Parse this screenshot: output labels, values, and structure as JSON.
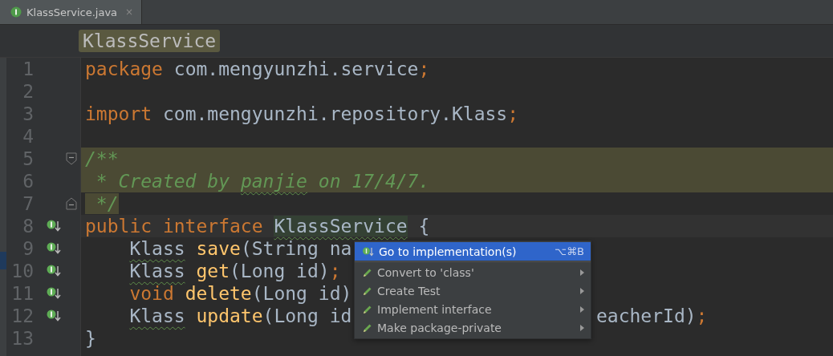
{
  "tab": {
    "title": "KlassService.java",
    "close": "×",
    "selected": true
  },
  "breadcrumb": {
    "label": "KlassService"
  },
  "lines": [
    {
      "number": "1",
      "tokens": [
        {
          "text": "package",
          "kind": "keyword"
        },
        {
          "text": " com.mengyunzhi.service",
          "kind": "plain"
        },
        {
          "text": ";",
          "kind": "keyword"
        }
      ]
    },
    {
      "number": "2"
    },
    {
      "number": "3",
      "tokens": [
        {
          "text": "import",
          "kind": "keyword"
        },
        {
          "text": " com.mengyunzhi.repository.Klass",
          "kind": "plain"
        },
        {
          "text": ";",
          "kind": "keyword"
        }
      ]
    },
    {
      "number": "4"
    },
    {
      "number": "5",
      "highlighted": true,
      "fold_start": true,
      "tokens": [
        {
          "text": "/**",
          "kind": "comment"
        }
      ]
    },
    {
      "number": "6",
      "highlighted": true,
      "tokens": [
        {
          "text": " * Created by ",
          "kind": "comment"
        },
        {
          "text": "panjie",
          "kind": "comment",
          "warn": true
        },
        {
          "text": " on 17/4/7.",
          "kind": "comment"
        }
      ]
    },
    {
      "number": "7",
      "highlighted": true,
      "fold_end": true,
      "tokens": [
        {
          "text": " */",
          "kind": "comment"
        }
      ]
    },
    {
      "number": "8",
      "current": true,
      "implemented": true,
      "tokens": [
        {
          "text": "public interface ",
          "kind": "keyword"
        },
        {
          "text": "KlassService",
          "kind": "plain",
          "warn": true,
          "marked": true
        },
        {
          "text": " {",
          "kind": "plain"
        }
      ]
    },
    {
      "number": "9",
      "implemented": true,
      "indented": true,
      "tokens": [
        {
          "text": "Klass",
          "kind": "plain",
          "warn": true
        },
        {
          "text": " save",
          "kind": "method"
        },
        {
          "text": "(String na",
          "kind": "plain"
        }
      ]
    },
    {
      "number": "10",
      "implemented": true,
      "indented": true,
      "tokens": [
        {
          "text": "Klass",
          "kind": "plain",
          "warn": true
        },
        {
          "text": " get",
          "kind": "method"
        },
        {
          "text": "(Long id)",
          "kind": "plain"
        },
        {
          "text": ";",
          "kind": "keyword"
        }
      ]
    },
    {
      "number": "11",
      "implemented": true,
      "indented": true,
      "tokens": [
        {
          "text": "void ",
          "kind": "keyword"
        },
        {
          "text": "delete",
          "kind": "method"
        },
        {
          "text": "(Long id)",
          "kind": "plain"
        }
      ]
    },
    {
      "number": "12",
      "implemented": true,
      "indented": true,
      "tokens": [
        {
          "text": "Klass",
          "kind": "plain",
          "warn": true
        },
        {
          "text": " update",
          "kind": "method"
        },
        {
          "text": "(Long id",
          "kind": "plain"
        }
      ],
      "after_popup": [
        {
          "text": "eacherId)",
          "kind": "plain"
        },
        {
          "text": ";",
          "kind": "keyword"
        }
      ]
    },
    {
      "number": "13",
      "tokens": [
        {
          "text": "}",
          "kind": "plain"
        }
      ]
    }
  ],
  "popup": {
    "items": [
      {
        "label": "Go to implementation(s)",
        "kind": "navigate",
        "shortcut": "⌥⌘B",
        "submenu": false,
        "selected": true
      },
      {
        "label": "Convert to 'class'",
        "kind": "intention",
        "submenu": true,
        "selected": false
      },
      {
        "label": "Create Test",
        "kind": "intention",
        "submenu": true,
        "selected": false
      },
      {
        "label": "Implement interface",
        "kind": "intention",
        "submenu": true,
        "selected": false
      },
      {
        "label": "Make package-private",
        "kind": "intention",
        "submenu": true,
        "selected": false
      }
    ]
  }
}
